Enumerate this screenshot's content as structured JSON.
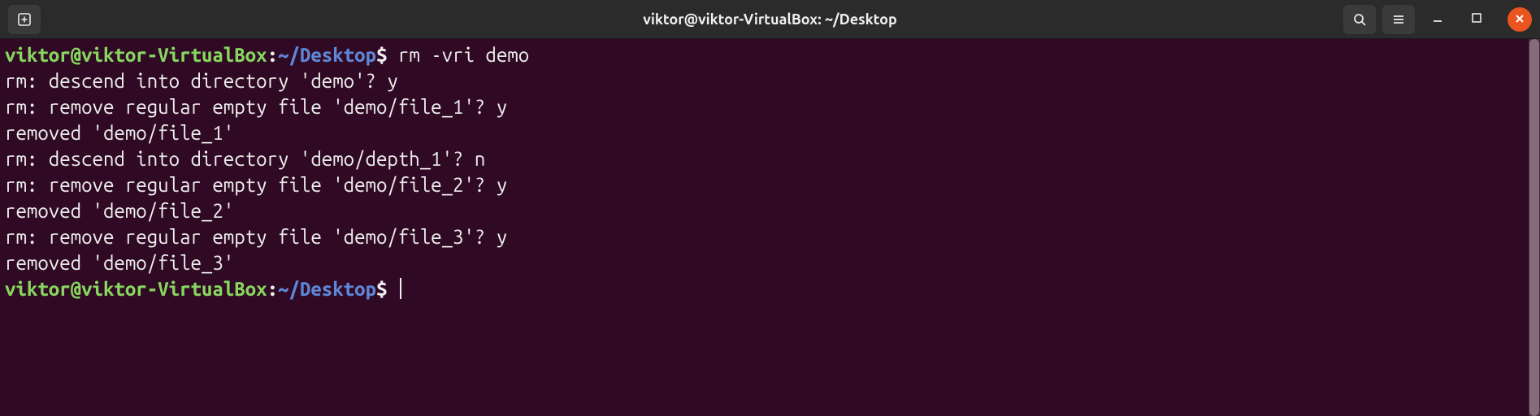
{
  "window": {
    "title": "viktor@viktor-VirtualBox: ~/Desktop"
  },
  "colors": {
    "background": "#300a24",
    "titlebar": "#2b2b2b",
    "close": "#e95420",
    "ps1_user": "#87d75f",
    "ps1_path": "#5f87d7",
    "text": "#eeeeee"
  },
  "prompt": {
    "user_host": "viktor@viktor-VirtualBox",
    "separator": ":",
    "path": "~/Desktop",
    "symbol": "$"
  },
  "lines": {
    "cmd1": "rm -vri demo",
    "l2": "rm: descend into directory 'demo'? y",
    "l3": "rm: remove regular empty file 'demo/file_1'? y",
    "l4": "removed 'demo/file_1'",
    "l5": "rm: descend into directory 'demo/depth_1'? n",
    "l6": "rm: remove regular empty file 'demo/file_2'? y",
    "l7": "removed 'demo/file_2'",
    "l8": "rm: remove regular empty file 'demo/file_3'? y",
    "l9": "removed 'demo/file_3'",
    "cmd2": ""
  },
  "icons": {
    "new_tab": "new-tab-icon",
    "search": "search-icon",
    "menu": "hamburger-menu-icon",
    "minimize": "minimize-icon",
    "maximize": "maximize-icon",
    "close": "close-icon"
  }
}
